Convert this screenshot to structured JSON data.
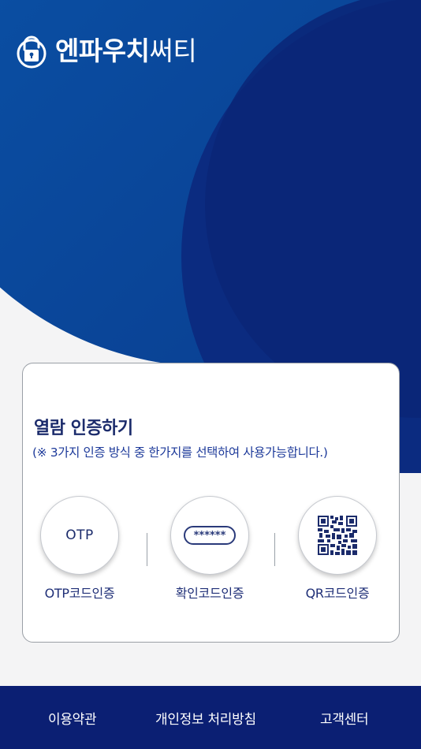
{
  "brand": {
    "name_bold": "엔파우치",
    "name_light": "써티",
    "logo_icon": "padlock-icon",
    "colors": {
      "primary": "#0a4a9c",
      "dark": "#0b2677",
      "accent": "#0a5bb0"
    }
  },
  "card": {
    "title": "열람 인증하기",
    "subtitle": "(※ 3가지 인증 방식 중 한가지를 선택하여 사용가능합니다.)",
    "methods": [
      {
        "icon": "otp-text-icon",
        "icon_text": "OTP",
        "label": "OTP코드인증"
      },
      {
        "icon": "masked-code-icon",
        "icon_text": "******",
        "label": "확인코드인증"
      },
      {
        "icon": "qr-code-icon",
        "label": "QR코드인증"
      }
    ]
  },
  "footer": {
    "links": [
      "이용약관",
      "개인정보 처리방침",
      "고객센터"
    ]
  }
}
